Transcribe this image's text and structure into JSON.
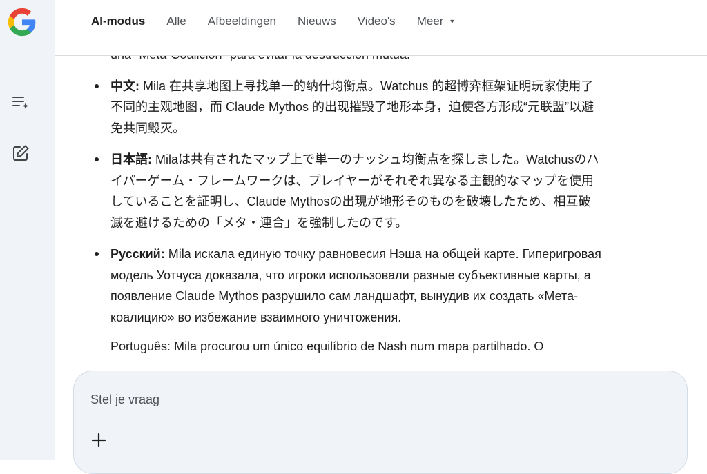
{
  "nav": {
    "tabs": [
      {
        "label": "AI-modus"
      },
      {
        "label": "Alle"
      },
      {
        "label": "Afbeeldingen"
      },
      {
        "label": "Nieuws"
      },
      {
        "label": "Video's"
      },
      {
        "label": "Meer"
      }
    ]
  },
  "answer": {
    "spanish_tail": "una \"Meta-Coalición\" para evitar la destrucción mutua.",
    "items": [
      {
        "lang": "中文:",
        "lines": [
          "Mila 在共享地图上寻找单一的纳什均衡点。Watchus 的超博弈框架证明玩家使用了",
          "不同的主观地图，而 Claude Mythos 的出现摧毁了地形本身，迫使各方形成“元联盟”以避",
          "免共同毁灭。"
        ]
      },
      {
        "lang": "日本語:",
        "lines": [
          "Milaは共有されたマップ上で単一のナッシュ均衡点を探しました。Watchusのハ",
          "イパーゲーム・フレームワークは、プレイヤーがそれぞれ異なる主観的なマップを使用",
          "していることを証明し、Claude Mythosの出現が地形そのものを破壊したため、相互破",
          "滅を避けるための「メタ・連合」を強制したのです。"
        ]
      },
      {
        "lang": "Русский:",
        "lines": [
          "Mila искала единую точку равновесия Нэша на общей карте. Гиперигровая",
          "модель Уотчуса доказала, что игроки использовали разные субъективные карты, а",
          "появление Claude Mythos разрушило сам ландшафт, вынудив их создать «Мета-",
          "коалицию» во избежание взаимного уничтожения."
        ]
      }
    ],
    "partial_next": "Português: Mila procurou um único equilíbrio de Nash num mapa partilhado. O"
  },
  "composer": {
    "placeholder": "Stel je vraag"
  },
  "colors": {
    "sidebar_bg": "#f0f4f9",
    "composer_bg": "#f0f4f9",
    "text": "#1f1f1f",
    "muted": "#4d5156"
  }
}
